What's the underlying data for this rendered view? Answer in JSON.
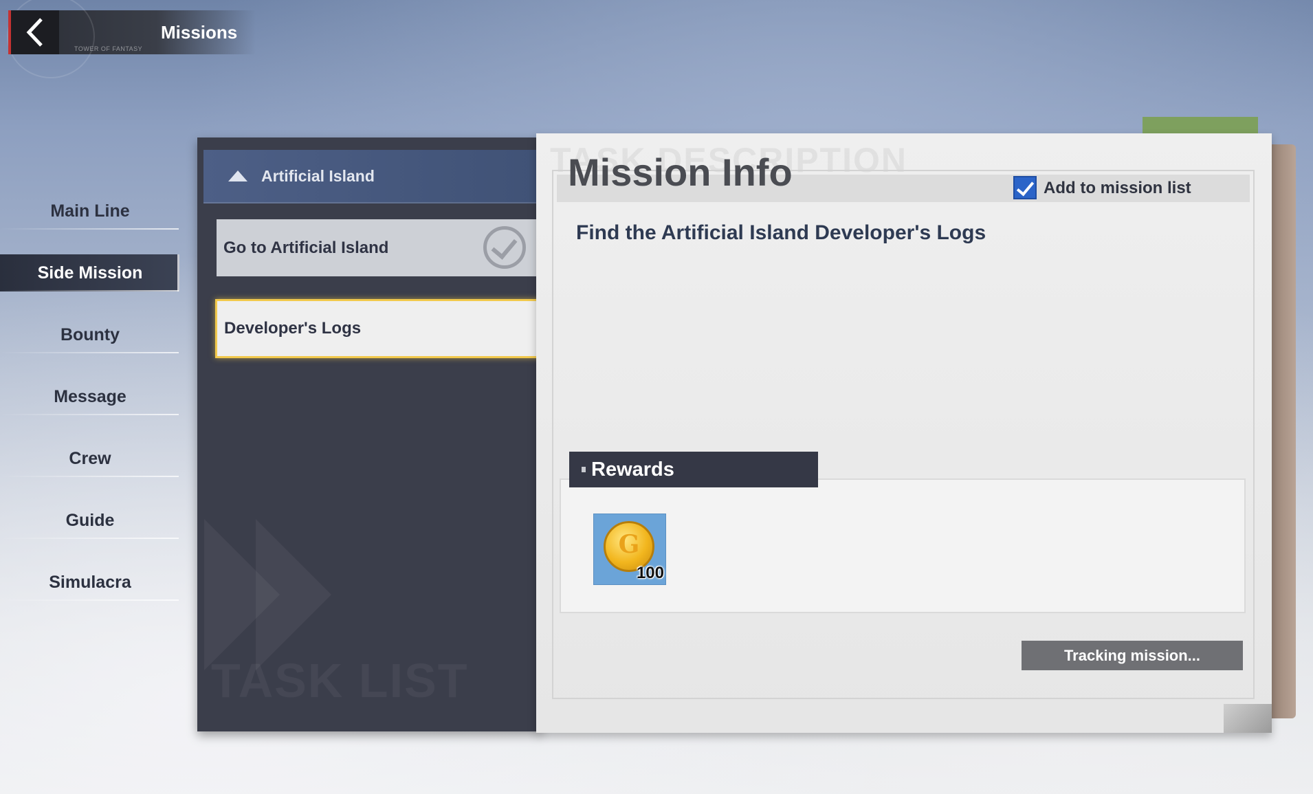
{
  "header": {
    "title": "Missions",
    "emblem_text": "TOWER OF FANTASY"
  },
  "categories": [
    {
      "label": "Main Line",
      "active": false
    },
    {
      "label": "Side Mission",
      "active": true
    },
    {
      "label": "Bounty",
      "active": false
    },
    {
      "label": "Message",
      "active": false
    },
    {
      "label": "Crew",
      "active": false
    },
    {
      "label": "Guide",
      "active": false
    },
    {
      "label": "Simulacra",
      "active": false
    }
  ],
  "task_list": {
    "watermark": "TASK LIST",
    "group": {
      "label": "Artificial Island",
      "expanded": true
    },
    "tasks": [
      {
        "label": "Go to Artificial Island",
        "status": "completed"
      },
      {
        "label": "Developer's Logs",
        "status": "selected"
      }
    ]
  },
  "mission_info": {
    "watermark": "TASK DESCRIPTION",
    "title": "Mission Info",
    "add_to_list_label": "Add to mission list",
    "add_to_list_checked": true,
    "description": "Find the Artificial Island Developer's Logs",
    "rewards_label": "Rewards",
    "rewards": [
      {
        "icon": "gold-coin-icon",
        "quantity": "100"
      }
    ],
    "tracking_label": "Tracking mission..."
  },
  "colors": {
    "accent_blue": "#2b64c8",
    "selected_border": "#f2c94c",
    "panel_dark": "#3b3e4b",
    "back_accent": "#c43232"
  }
}
